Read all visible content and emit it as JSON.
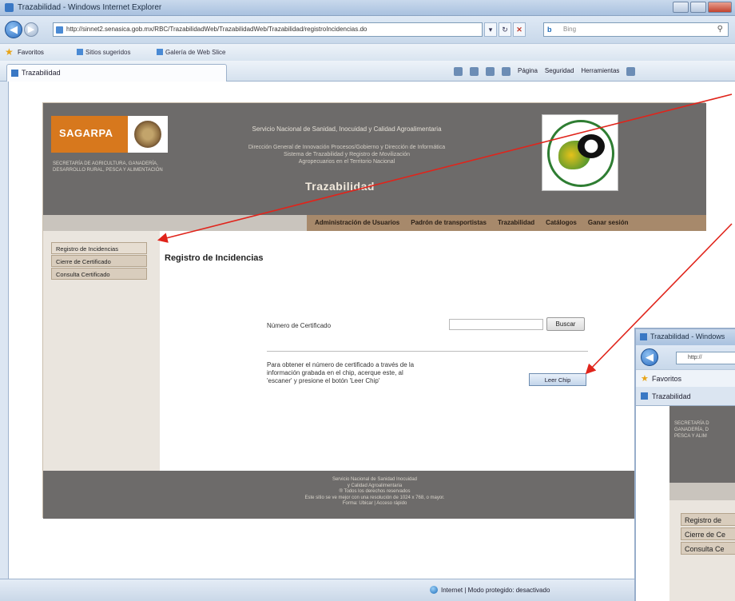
{
  "window": {
    "title": "Trazabilidad - Windows Internet Explorer",
    "url": "http://sinnet2.senasica.gob.mx/RBC/TrazabilidadWeb/TrazabilidadWeb/Trazabilidad/registroIncidencias.do",
    "search_placeholder": "Bing",
    "favorites_label": "Favoritos",
    "favorites_items": [
      "Sitios sugeridos",
      "Galería de Web Slice"
    ],
    "tab_label": "Trazabilidad",
    "command_items": [
      "Página",
      "Seguridad",
      "Herramientas"
    ],
    "status_zone": "Internet | Modo protegido: desactivado"
  },
  "site": {
    "logo_text": "SAGARPA",
    "secretaria_text": "SECRETARÍA DE AGRICULTURA, GANADERÍA, DESARROLLO RURAL, PESCA Y ALIMENTACIÓN",
    "header_title": "Servicio Nacional de Sanidad, Inocuidad y Calidad Agroalimentaria",
    "header_sub1": "Dirección General de Innovación Procesos/Gobierno y Dirección de Informática",
    "header_sub2": "Sistema de Trazabilidad y Registro de Movilización",
    "header_sub3": "Agropecuarios en el Territorio Nacional",
    "brand": "Trazabilidad",
    "menu": [
      "Administración de Usuarios",
      "Padrón de transportistas",
      "Trazabilidad",
      "Catálogos",
      "Ganar sesión"
    ],
    "sidebar": [
      "Registro de Incidencias",
      "Cierre de Certificado",
      "Consulta Certificado"
    ],
    "page_heading": "Registro de Incidencias",
    "cert_label": "Número de Certificado",
    "buscar_label": "Buscar",
    "chip_text": "Para obtener el número de certificado a través de la información grabada en el chip, acerque este, al 'escaner' y presione el botón 'Leer Chip'",
    "leer_label": "Leer Chip",
    "footer_lines": [
      "Servicio Nacional de Sanidad Inocuidad",
      "y Calidad Agroalimentaria",
      "® Todos los derechos reservados",
      "Este sitio se ve mejor con una resolución de 1024 x 768, o mayor.",
      "Forma: Ubicar | Acceso rápido"
    ]
  },
  "second_window": {
    "title": "Trazabilidad - Windows",
    "url": "http://",
    "favorites_label": "Favoritos",
    "tab_label": "Trazabilidad",
    "header_lines": [
      "SECRETARÍA D",
      "GANADERÍA, D",
      "PESCA Y ALIM"
    ],
    "sidebar": [
      "Registro de",
      "Cierre de Ce",
      "Consulta Ce"
    ]
  },
  "colors": {
    "header_gray": "#6d6b6a",
    "sagarpa_orange": "#d7781d",
    "menu_brown": "#a7896b",
    "annotation_red": "#e0241b"
  }
}
